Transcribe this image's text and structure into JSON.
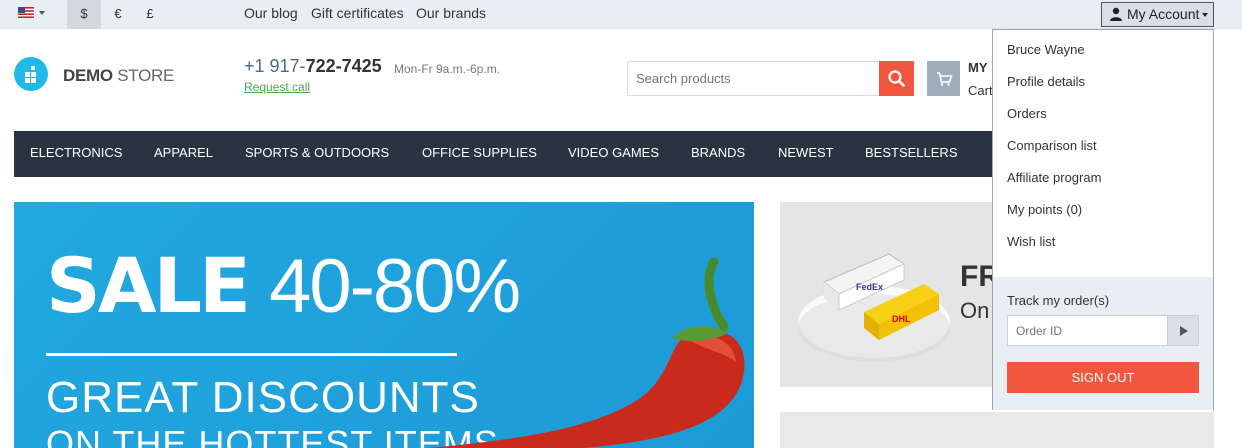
{
  "topbar": {
    "language_icon": "us-flag-icon",
    "currencies": [
      "$",
      "€",
      "£"
    ],
    "active_currency": "$",
    "links": [
      "Our blog",
      "Gift certificates",
      "Our brands"
    ],
    "account_label": "My Account"
  },
  "header": {
    "logo_bold": "DEMO",
    "logo_light": "STORE",
    "phone_prefix": "+1 917-",
    "phone_main": "722-7425",
    "hours": "Mon-Fr 9a.m.-6p.m.",
    "request_call": "Request call",
    "search_placeholder": "Search products",
    "cart_title": "MY",
    "cart_sub": "Cart"
  },
  "nav": {
    "items": [
      "Electronics",
      "Apparel",
      "Sports & Outdoors",
      "Office Supplies",
      "Video Games",
      "Brands",
      "Newest",
      "Bestsellers"
    ]
  },
  "banner": {
    "sale_bold": "SALE",
    "sale_range": "40-80%",
    "line1": "GREAT DISCOUNTS",
    "line2": "ON THE HOTTEST ITEMS"
  },
  "shipping": {
    "title": "FR",
    "subtitle": "On"
  },
  "account_menu": {
    "user_name": "Bruce Wayne",
    "items": [
      "Profile details",
      "Orders",
      "Comparison list",
      "Affiliate program",
      "My points (0)",
      "Wish list"
    ],
    "track_label": "Track my order(s)",
    "order_placeholder": "Order ID",
    "sign_out": "Sign out"
  },
  "colors": {
    "accent": "#f1563f",
    "nav_bg": "#2a3441",
    "logo": "#20b9ea",
    "banner": "#1ea2dc"
  }
}
